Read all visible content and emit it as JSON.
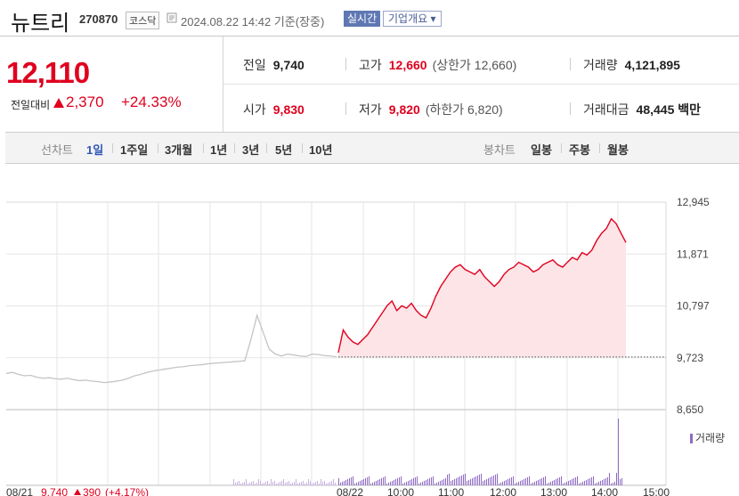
{
  "header": {
    "name": "뉴트리",
    "code": "270870",
    "market": "코스닥",
    "timestamp": "2024.08.22 14:42 기준(장중)",
    "realtime_label": "실시간",
    "company_label": "기업개요"
  },
  "price": {
    "current": "12,110",
    "change_label": "전일대비",
    "change": "2,370",
    "change_pct": "+24.33%"
  },
  "stats": {
    "prev_close": {
      "label": "전일",
      "value": "9,740"
    },
    "high": {
      "label": "고가",
      "value": "12,660",
      "sub": "(상한가 12,660)"
    },
    "volume": {
      "label": "거래량",
      "value": "4,121,895"
    },
    "open": {
      "label": "시가",
      "value": "9,830"
    },
    "low": {
      "label": "저가",
      "value": "9,820",
      "sub": "(하한가 6,820)"
    },
    "amount": {
      "label": "거래대금",
      "value": "48,445",
      "unit": "백만"
    }
  },
  "tabs": {
    "line_label": "선차트",
    "line_periods": [
      "1일",
      "1주일",
      "3개월",
      "1년",
      "3년",
      "5년",
      "10년"
    ],
    "active_period": "1일",
    "candle_label": "봉차트",
    "candle_periods": [
      "일봉",
      "주봉",
      "월봉"
    ]
  },
  "colors": {
    "up": "#e0001e",
    "accent": "#5f77b3"
  },
  "chart_data": {
    "type": "line",
    "ylim": [
      8650,
      12945
    ],
    "ytick_labels": [
      "12,945",
      "11,871",
      "10,797",
      "9,723",
      "8,650"
    ],
    "yticks": [
      12945,
      11871,
      10797,
      9723,
      8650
    ],
    "x_labels": [
      "08/21",
      "08/22",
      "10:00",
      "11:00",
      "12:00",
      "13:00",
      "14:00",
      "15:00"
    ],
    "volume_legend": "거래량",
    "prev_day_footer": {
      "date": "08/21",
      "close": "9,740",
      "change": "390",
      "pct": "(+4.17%)"
    },
    "baseline": 9740,
    "series": [
      {
        "day": "08/21",
        "values": [
          9400,
          9420,
          9380,
          9350,
          9360,
          9320,
          9300,
          9310,
          9290,
          9280,
          9300,
          9270,
          9250,
          9260,
          9240,
          9230,
          9210,
          9220,
          9240,
          9260,
          9300,
          9350,
          9380,
          9420,
          9450,
          9470,
          9490,
          9510,
          9530,
          9540,
          9560,
          9570,
          9580,
          9600,
          9610,
          9620,
          9630,
          9640,
          9650,
          9660,
          10100,
          10600,
          10250,
          9900,
          9800,
          9760,
          9800,
          9780,
          9760,
          9750,
          9800,
          9790,
          9770,
          9760,
          9740
        ]
      },
      {
        "day": "08/22",
        "values": [
          9830,
          10300,
          10150,
          10050,
          10000,
          10100,
          10200,
          10350,
          10500,
          10650,
          10800,
          10900,
          10700,
          10800,
          10750,
          10850,
          10700,
          10600,
          10550,
          10750,
          11000,
          11200,
          11350,
          11500,
          11600,
          11650,
          11550,
          11500,
          11450,
          11550,
          11400,
          11300,
          11200,
          11300,
          11450,
          11550,
          11600,
          11700,
          11650,
          11600,
          11500,
          11550,
          11650,
          11700,
          11750,
          11650,
          11600,
          11700,
          11800,
          11750,
          11900,
          11850,
          11950,
          12150,
          12300,
          12400,
          12600,
          12500,
          12300,
          12110
        ]
      }
    ]
  }
}
